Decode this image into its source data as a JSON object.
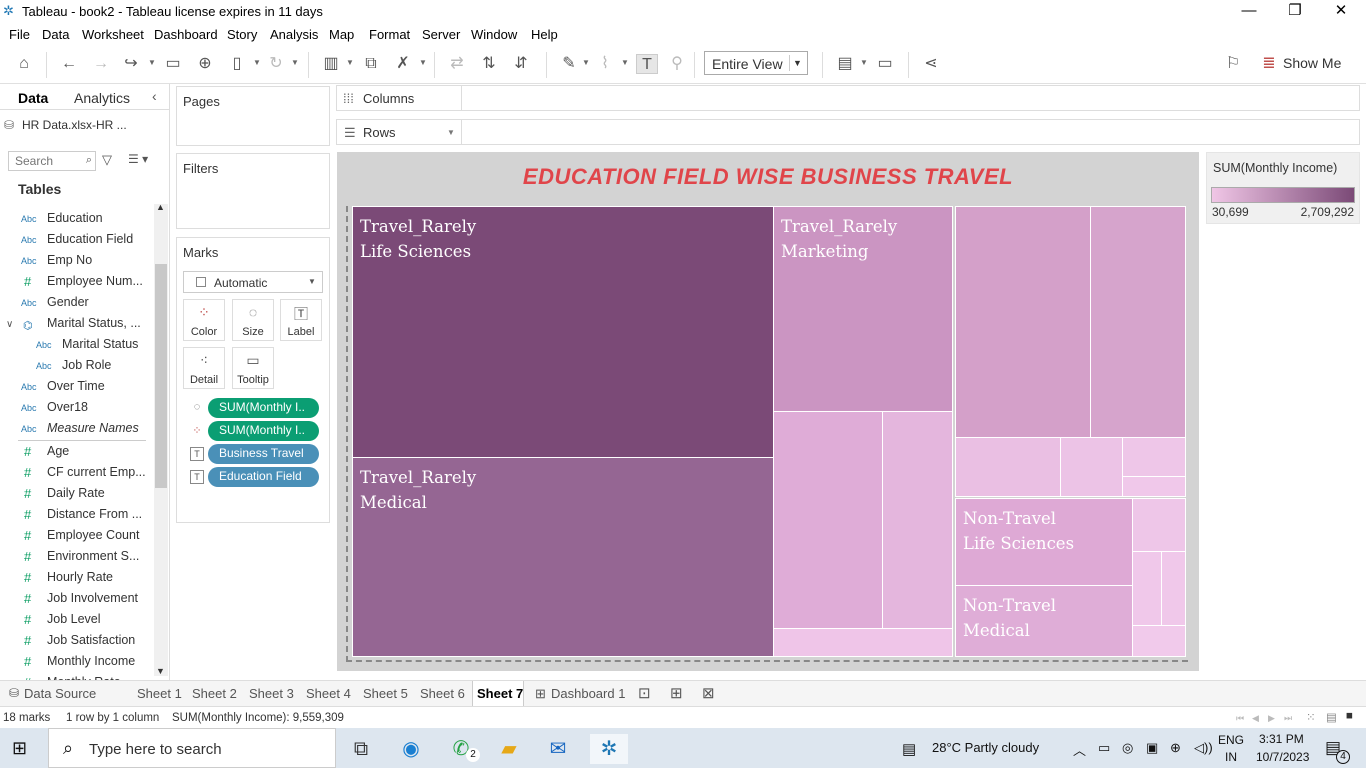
{
  "window": {
    "title": "Tableau - book2 - Tableau license expires in 11 days",
    "controls": {
      "minimize": "—",
      "restore": "❐",
      "close": "✕"
    }
  },
  "menu": [
    "File",
    "Data",
    "Worksheet",
    "Dashboard",
    "Story",
    "Analysis",
    "Map",
    "Format",
    "Server",
    "Window",
    "Help"
  ],
  "toolbar": {
    "fit_label": "Entire View",
    "show_me_label": "Show Me"
  },
  "data_pane": {
    "tab_data": "Data",
    "tab_analytics": "Analytics",
    "source": "HR Data.xlsx-HR ...",
    "search_placeholder": "Search",
    "tables_heading": "Tables",
    "fields": [
      {
        "type": "Abc",
        "name": "Education",
        "indent": 0
      },
      {
        "type": "Abc",
        "name": "Education Field",
        "indent": 0
      },
      {
        "type": "Abc",
        "name": "Emp No",
        "indent": 0
      },
      {
        "type": "#",
        "name": "Employee Num...",
        "indent": 0
      },
      {
        "type": "Abc",
        "name": "Gender",
        "indent": 0
      },
      {
        "type": "hier",
        "name": "Marital Status, ...",
        "indent": 0
      },
      {
        "type": "Abc",
        "name": "Marital Status",
        "indent": 1
      },
      {
        "type": "Abc",
        "name": "Job Role",
        "indent": 1
      },
      {
        "type": "Abc",
        "name": "Over Time",
        "indent": 0
      },
      {
        "type": "Abc",
        "name": "Over18",
        "indent": 0
      },
      {
        "type": "Abc",
        "name": "Measure Names",
        "indent": 0,
        "italic": true
      },
      {
        "type": "#",
        "name": "Age",
        "indent": 0
      },
      {
        "type": "#",
        "name": "CF current Emp...",
        "indent": 0
      },
      {
        "type": "#",
        "name": "Daily Rate",
        "indent": 0
      },
      {
        "type": "#",
        "name": "Distance From ...",
        "indent": 0
      },
      {
        "type": "#",
        "name": "Employee Count",
        "indent": 0
      },
      {
        "type": "#",
        "name": "Environment S...",
        "indent": 0
      },
      {
        "type": "#",
        "name": "Hourly Rate",
        "indent": 0
      },
      {
        "type": "#",
        "name": "Job Involvement",
        "indent": 0
      },
      {
        "type": "#",
        "name": "Job Level",
        "indent": 0
      },
      {
        "type": "#",
        "name": "Job Satisfaction",
        "indent": 0
      },
      {
        "type": "#",
        "name": "Monthly Income",
        "indent": 0
      },
      {
        "type": "#",
        "name": "Monthly Rate",
        "indent": 0
      }
    ]
  },
  "cards": {
    "pages": "Pages",
    "filters": "Filters",
    "marks": "Marks",
    "mark_type": "Automatic",
    "mark_buttons": [
      {
        "label": "Color",
        "icon": "color-icon"
      },
      {
        "label": "Size",
        "icon": "size-icon"
      },
      {
        "label": "Label",
        "icon": "label-icon"
      },
      {
        "label": "Detail",
        "icon": "detail-icon"
      },
      {
        "label": "Tooltip",
        "icon": "tooltip-icon"
      }
    ],
    "pills": [
      {
        "text": "SUM(Monthly I..",
        "color": "green",
        "icon": "size-icon"
      },
      {
        "text": "SUM(Monthly I..",
        "color": "green",
        "icon": "color-icon"
      },
      {
        "text": "Business Travel",
        "color": "blue",
        "icon": "label-icon"
      },
      {
        "text": "Education Field",
        "color": "blue",
        "icon": "label-icon"
      }
    ]
  },
  "shelves": {
    "columns": "Columns",
    "rows": "Rows"
  },
  "viz": {
    "title": "EDUCATION FIELD WISE BUSINESS TRAVEL",
    "labels": [
      "Travel_Rarely\nLife Sciences",
      "Travel_Rarely\nMarketing",
      "Travel_Rarely\nMedical",
      "Non-Travel\nLife Sciences",
      "Non-Travel\nMedical"
    ]
  },
  "legend": {
    "title": "SUM(Monthly Income)",
    "min": "30,699",
    "max": "2,709,292",
    "color_low": "#f0c6e6",
    "color_high": "#7b4a77"
  },
  "sheets": {
    "data_source": "Data Source",
    "tabs": [
      "Sheet 1",
      "Sheet 2",
      "Sheet 3",
      "Sheet 4",
      "Sheet 5",
      "Sheet 6",
      "Sheet 7"
    ],
    "active": "Sheet 7",
    "dashboard": "Dashboard 1"
  },
  "status": {
    "marks": "18 marks",
    "dims": "1 row by 1 column",
    "sum": "SUM(Monthly Income): 9,559,309"
  },
  "taskbar": {
    "search_placeholder": "Type here to search",
    "weather": "28°C  Partly cloudy",
    "lang": "ENG",
    "region": "IN",
    "time": "3:31 PM",
    "date": "10/7/2023",
    "whatsapp_badge": "2",
    "notif_badge": "4"
  }
}
